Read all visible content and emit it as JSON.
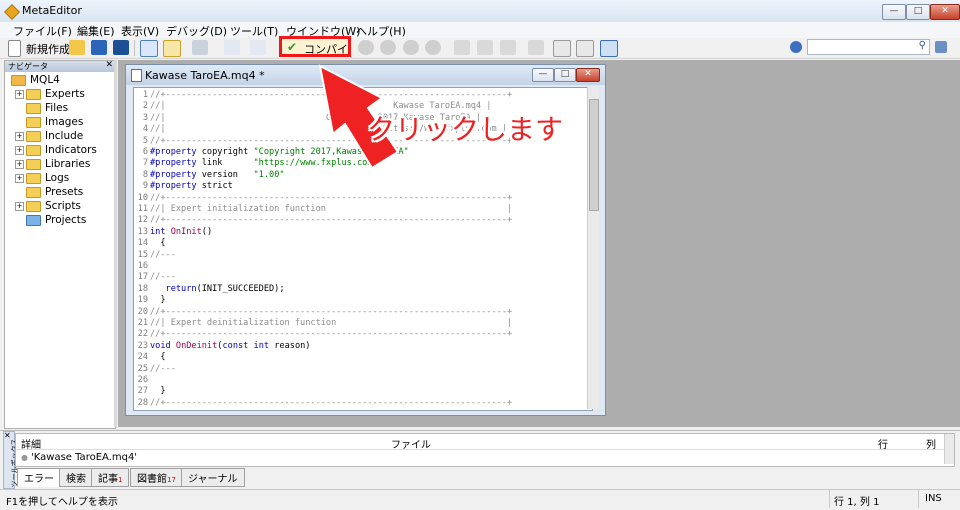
{
  "window": {
    "title": "MetaEditor"
  },
  "menu": [
    "ファイル(F)",
    "編集(E)",
    "表示(V)",
    "デバッグ(D)",
    "ツール(T)",
    "ウインドウ(W)",
    "ヘルプ(H)"
  ],
  "toolbar": {
    "new_label": "新規作成",
    "compile_label": "コンパイル",
    "search_placeholder": ""
  },
  "navigator": {
    "title": "ナビゲータ",
    "root": "MQL4",
    "items": [
      "Experts",
      "Files",
      "Images",
      "Include",
      "Indicators",
      "Libraries",
      "Logs",
      "Presets",
      "Scripts",
      "Projects"
    ]
  },
  "editor": {
    "tab_title": "Kawase TaroEA.mq4 *",
    "lines": [
      {
        "n": "1",
        "text": "//+------------------------------------------------------------------+"
      },
      {
        "n": "2",
        "text": "//|                                            Kawase TaroEA.mq4 |"
      },
      {
        "n": "3",
        "text": "//|                               Copyright 2017,Kawase TaroEA |"
      },
      {
        "n": "4",
        "text": "//|                                          https://www.fxplus.com |"
      },
      {
        "n": "5",
        "text": "//+------------------------------------------------------------------+"
      },
      {
        "n": "6",
        "text": "#property copyright \"Copyright 2017,Kawase TaroEA\""
      },
      {
        "n": "7",
        "text": "#property link      \"https://www.fxplus.com\""
      },
      {
        "n": "8",
        "text": "#property version   \"1.00\""
      },
      {
        "n": "9",
        "text": "#property strict"
      },
      {
        "n": "10",
        "text": "//+------------------------------------------------------------------+"
      },
      {
        "n": "11",
        "text": "//| Expert initialization function                                   |"
      },
      {
        "n": "12",
        "text": "//+------------------------------------------------------------------+"
      },
      {
        "n": "13",
        "text": "int OnInit()"
      },
      {
        "n": "14",
        "text": "  {"
      },
      {
        "n": "15",
        "text": "//---"
      },
      {
        "n": "16",
        "text": ""
      },
      {
        "n": "17",
        "text": "//---"
      },
      {
        "n": "18",
        "text": "   return(INIT_SUCCEEDED);"
      },
      {
        "n": "19",
        "text": "  }"
      },
      {
        "n": "20",
        "text": "//+------------------------------------------------------------------+"
      },
      {
        "n": "21",
        "text": "//| Expert deinitialization function                                 |"
      },
      {
        "n": "22",
        "text": "//+------------------------------------------------------------------+"
      },
      {
        "n": "23",
        "text": "void OnDeinit(const int reason)"
      },
      {
        "n": "24",
        "text": "  {"
      },
      {
        "n": "25",
        "text": "//---"
      },
      {
        "n": "26",
        "text": ""
      },
      {
        "n": "27",
        "text": "  }"
      },
      {
        "n": "28",
        "text": "//+------------------------------------------------------------------+"
      }
    ]
  },
  "annotation": {
    "text": "クリックします",
    "color": "#ee2222"
  },
  "toolbox": {
    "side_label": "ツールボックス",
    "headers": {
      "details": "詳細",
      "file": "ファイル",
      "line": "行",
      "column": "列"
    },
    "row": "'Kawase TaroEA.mq4'",
    "tabs": [
      {
        "label": "エラー",
        "badge": ""
      },
      {
        "label": "検索",
        "badge": ""
      },
      {
        "label": "記事",
        "badge": "1"
      },
      {
        "label": "図書館",
        "badge": "17"
      },
      {
        "label": "ジャーナル",
        "badge": ""
      }
    ]
  },
  "status": {
    "help": "F1を押してヘルプを表示",
    "position": "行 1, 列 1",
    "mode": "INS"
  }
}
